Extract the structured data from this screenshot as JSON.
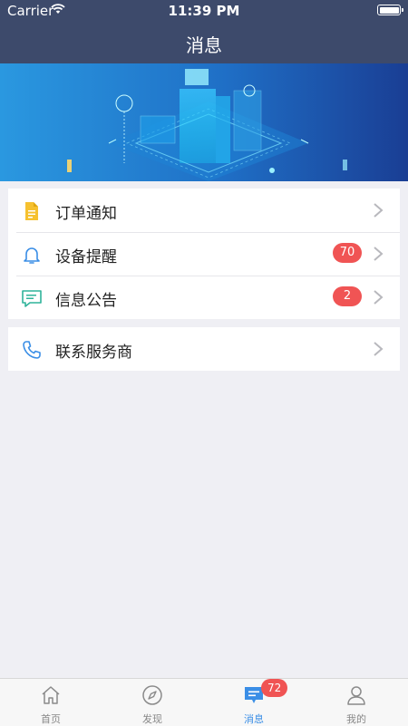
{
  "status_bar": {
    "carrier": "Carrier",
    "time": "11:39 PM"
  },
  "nav": {
    "title": "消息"
  },
  "colors": {
    "nav_bg": "#3d4a6b",
    "badge": "#f05454",
    "accent": "#3a8ee6"
  },
  "groups": [
    {
      "items": [
        {
          "label": "订单通知",
          "icon": "document-icon"
        },
        {
          "label": "设备提醒",
          "icon": "bell-icon",
          "badge": "70"
        },
        {
          "label": "信息公告",
          "icon": "chat-icon",
          "badge": "2"
        }
      ]
    },
    {
      "items": [
        {
          "label": "联系服务商",
          "icon": "phone-icon"
        }
      ]
    }
  ],
  "tabbar": {
    "tabs": [
      {
        "label": "首页",
        "icon": "home-icon"
      },
      {
        "label": "发现",
        "icon": "compass-icon"
      },
      {
        "label": "消息",
        "icon": "message-icon",
        "badge": "72",
        "active": true
      },
      {
        "label": "我的",
        "icon": "user-icon"
      }
    ]
  }
}
